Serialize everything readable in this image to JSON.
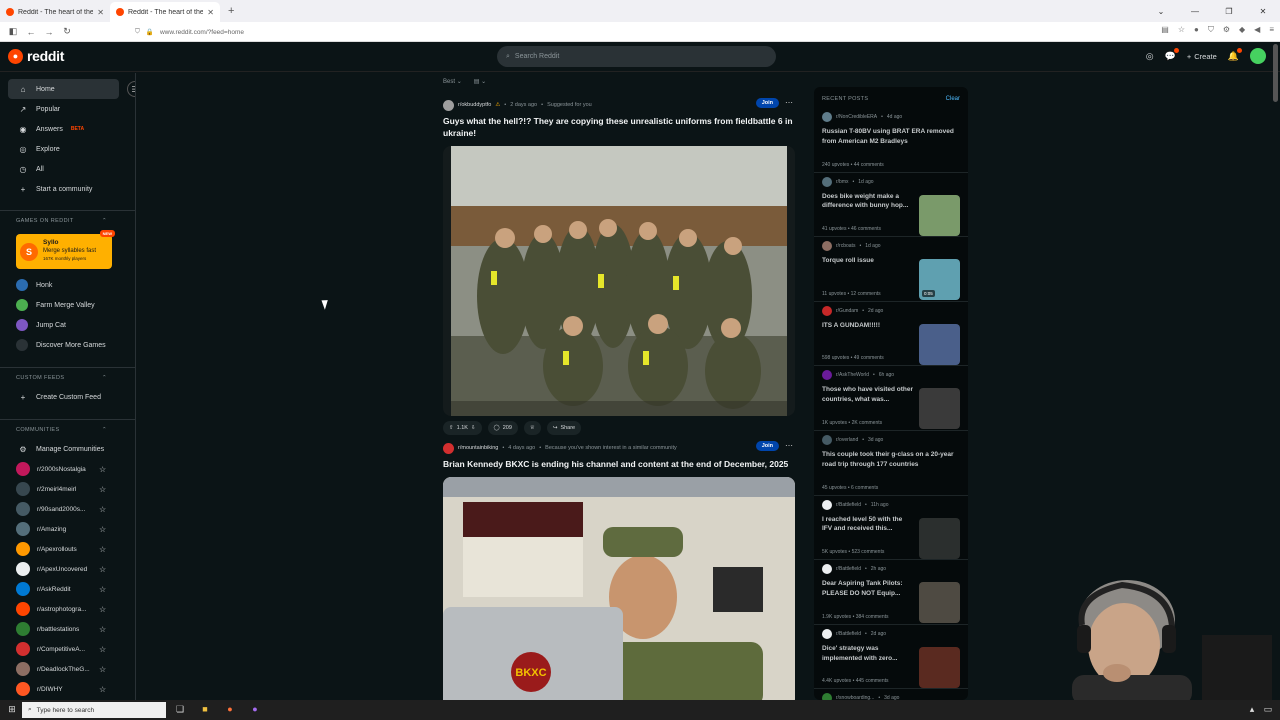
{
  "browser": {
    "tabs": [
      {
        "title": "Reddit - The heart of the intern"
      },
      {
        "title": "Reddit - The heart of the intern"
      }
    ],
    "url": "www.reddit.com/?feed=home"
  },
  "header": {
    "logo_text": "reddit",
    "search_placeholder": "Search Reddit",
    "create_label": "Create"
  },
  "sidebar": {
    "nav": [
      {
        "label": "Home",
        "icon": "home-icon"
      },
      {
        "label": "Popular",
        "icon": "popular-icon"
      },
      {
        "label": "Answers",
        "icon": "answers-icon",
        "badge": "BETA"
      },
      {
        "label": "Explore",
        "icon": "explore-icon"
      },
      {
        "label": "All",
        "icon": "all-icon"
      },
      {
        "label": "Start a community",
        "icon": "plus-icon"
      }
    ],
    "games_heading": "GAMES ON REDDIT",
    "featured_game": {
      "name": "Syllo",
      "desc": "Merge syllables fast",
      "players": "167K monthly players",
      "badge": "NEW"
    },
    "games": [
      {
        "label": "Honk"
      },
      {
        "label": "Farm Merge Valley"
      },
      {
        "label": "Jump Cat"
      },
      {
        "label": "Discover More Games"
      }
    ],
    "custom_heading": "CUSTOM FEEDS",
    "create_custom": "Create Custom Feed",
    "communities_heading": "COMMUNITIES",
    "manage": "Manage Communities",
    "communities": [
      {
        "name": "r/2000sNostalgia",
        "color": "#c2185b"
      },
      {
        "name": "r/2meirl4meirl",
        "color": "#37474f"
      },
      {
        "name": "r/90sand2000s...",
        "color": "#455a64"
      },
      {
        "name": "r/Amazing",
        "color": "#546e7a"
      },
      {
        "name": "r/Apexrollouts",
        "color": "#ff9800"
      },
      {
        "name": "r/ApexUncovered",
        "color": "#eceff1"
      },
      {
        "name": "r/AskReddit",
        "color": "#0079d3"
      },
      {
        "name": "r/astrophotogra...",
        "color": "#ff4500"
      },
      {
        "name": "r/battlestations",
        "color": "#2e7d32"
      },
      {
        "name": "r/CompetitiveA...",
        "color": "#d32f2f"
      },
      {
        "name": "r/DeadlockTheG...",
        "color": "#8d6e63"
      },
      {
        "name": "r/DIWHY",
        "color": "#ff5722"
      }
    ]
  },
  "feed": {
    "sort_label": "Best",
    "posts": [
      {
        "subreddit": "r/okbuddyptfo",
        "time": "2 days ago",
        "reason": "Suggested for you",
        "join": "Join",
        "title": "Guys what the hell?!? They are copying these unrealistic uniforms from fieldbattle 6 in ukraine!",
        "votes": "1.1K",
        "comments": "209",
        "share": "Share"
      },
      {
        "subreddit": "r/mountainbiking",
        "time": "4 days ago",
        "reason": "Because you've shown interest in a similar community",
        "join": "Join",
        "title": "Brian Kennedy BKXC is ending his channel and content at the end of December, 2025",
        "image_text": "BKXC"
      }
    ]
  },
  "recent": {
    "heading": "RECENT POSTS",
    "clear": "Clear",
    "items": [
      {
        "sub": "r/NonCredibleERA",
        "time": "4d ago",
        "title": "Russian T-80BV using BRAT ERA removed from American M2 Bradleys",
        "upvotes": "240 upvotes",
        "comments": "44 comments",
        "thumb": false,
        "color": "#607d8b"
      },
      {
        "sub": "r/bmx",
        "time": "1d ago",
        "title": "Does bike weight make a difference with bunny hop...",
        "upvotes": "41 upvotes",
        "comments": "46 comments",
        "thumb": true,
        "color": "#546e7a",
        "thumb_color": "#7a9a6a"
      },
      {
        "sub": "r/rcboats",
        "time": "1d ago",
        "title": "Torque roll issue",
        "upvotes": "11 upvotes",
        "comments": "12 comments",
        "thumb": true,
        "color": "#8d6e63",
        "thumb_color": "#5fa0b0",
        "duration": "0:05"
      },
      {
        "sub": "r/Gundam",
        "time": "2d ago",
        "title": "ITS A GUNDAM!!!!!",
        "upvotes": "598 upvotes",
        "comments": "49 comments",
        "thumb": true,
        "color": "#c62828",
        "thumb_color": "#4a5f8a"
      },
      {
        "sub": "r/AskTheWorld",
        "time": "6h ago",
        "title": "Those who have visited other countries, what was...",
        "upvotes": "1K upvotes",
        "comments": "2K comments",
        "thumb": true,
        "color": "#6a1b9a",
        "thumb_color": "#3a3a3a"
      },
      {
        "sub": "r/overland",
        "time": "3d ago",
        "title": "This couple took their g-class on a 20-year road trip through 177 countries",
        "upvotes": "45 upvotes",
        "comments": "6 comments",
        "thumb": false,
        "color": "#455a64"
      },
      {
        "sub": "r/Battlefield",
        "time": "11h ago",
        "title": "I reached level 50 with the IFV and received this...",
        "upvotes": "5K upvotes",
        "comments": "523 comments",
        "thumb": true,
        "color": "#eceff1",
        "thumb_color": "#2b2f2e"
      },
      {
        "sub": "r/Battlefield",
        "time": "2h ago",
        "title": "Dear Aspiring Tank Pilots: PLEASE DO NOT Equip...",
        "upvotes": "1.9K upvotes",
        "comments": "384 comments",
        "thumb": true,
        "color": "#eceff1",
        "thumb_color": "#4e4a42"
      },
      {
        "sub": "r/Battlefield",
        "time": "2d ago",
        "title": "Dice' strategy was implemented with zero...",
        "upvotes": "4.4K upvotes",
        "comments": "445 comments",
        "thumb": true,
        "color": "#eceff1",
        "thumb_color": "#5a2a20"
      },
      {
        "sub": "r/snowboarding...",
        "time": "3d ago",
        "title": "",
        "upvotes": "",
        "comments": "",
        "thumb": true,
        "color": "#2e7d32",
        "thumb_color": "#9aa0a0"
      }
    ]
  },
  "taskbar": {
    "search_placeholder": "Type here to search"
  }
}
